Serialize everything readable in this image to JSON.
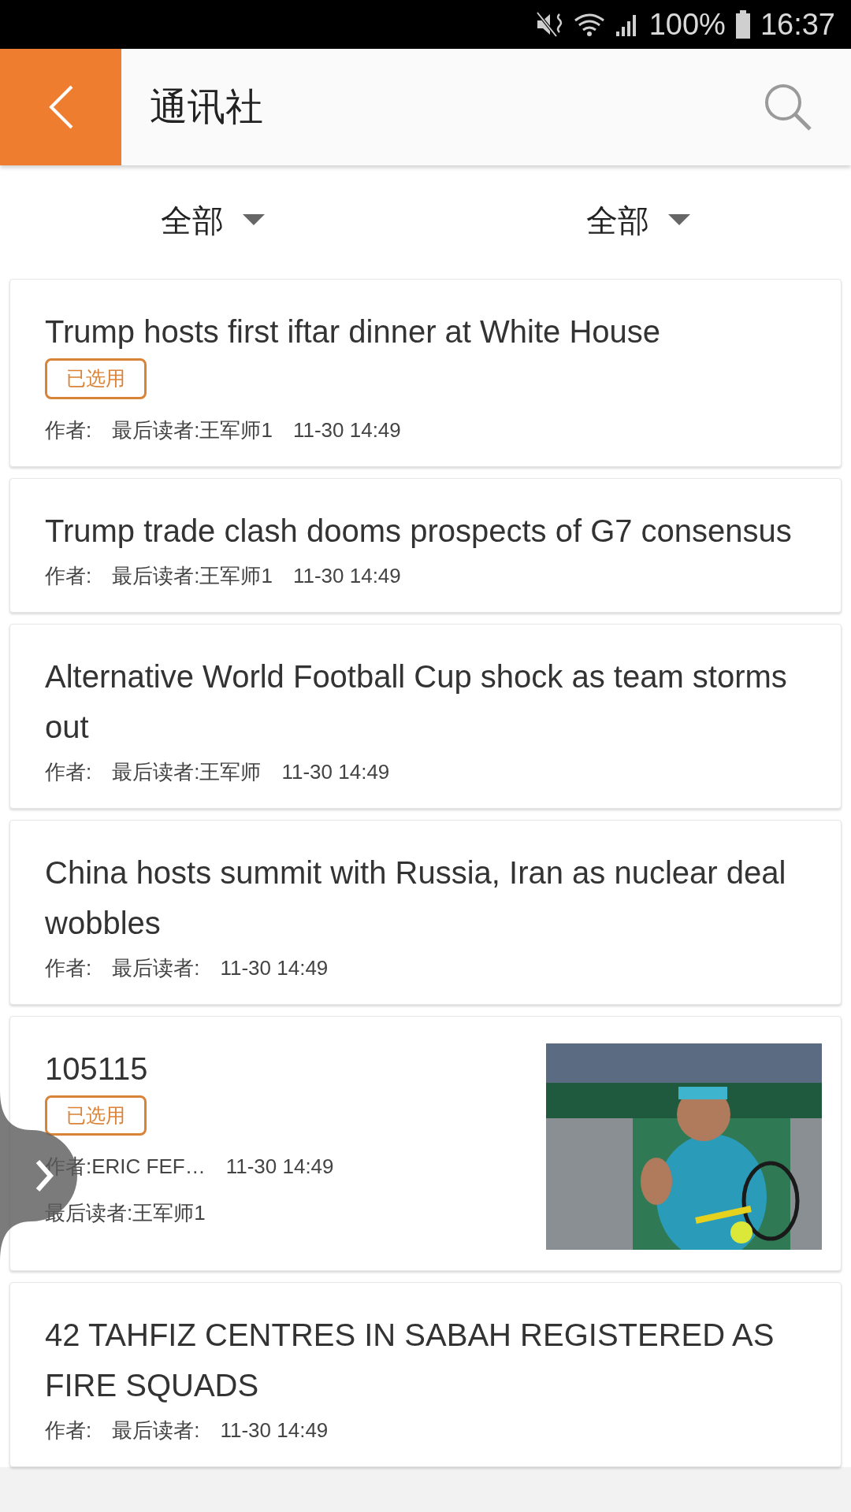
{
  "status_bar": {
    "battery": "100%",
    "time": "16:37"
  },
  "header": {
    "title": "通讯社"
  },
  "filters": [
    {
      "label": "全部"
    },
    {
      "label": "全部"
    }
  ],
  "articles": [
    {
      "title": "Trump hosts first iftar dinner at White House",
      "badge": "已选用",
      "meta": [
        [
          "作者:",
          "最后读者:王军师1",
          "11-30 14:49"
        ]
      ]
    },
    {
      "title": "Trump trade clash dooms prospects of G7 consensus",
      "meta": [
        [
          "作者:",
          "最后读者:王军师1",
          "11-30 14:49"
        ]
      ]
    },
    {
      "title": "Alternative World Football Cup shock as team storms out",
      "meta": [
        [
          "作者:",
          "最后读者:王军师",
          "11-30 14:49"
        ]
      ]
    },
    {
      "title": "China hosts summit with Russia, Iran as nuclear deal wobbles",
      "meta": [
        [
          "作者:",
          "最后读者:",
          "11-30 14:49"
        ]
      ]
    },
    {
      "title": "105115",
      "badge": "已选用",
      "thumbnail": {
        "kind": "picture"
      },
      "meta": [
        [
          "作者:ERIC FEF…",
          "11-30 14:49"
        ],
        [
          "最后读者:王军师1"
        ]
      ]
    },
    {
      "title": "42 TAHFIZ CENTRES IN SABAH REGISTERED AS FIRE SQUADS",
      "meta": [
        [
          "作者:",
          "最后读者:",
          "11-30 14:49"
        ]
      ]
    }
  ]
}
